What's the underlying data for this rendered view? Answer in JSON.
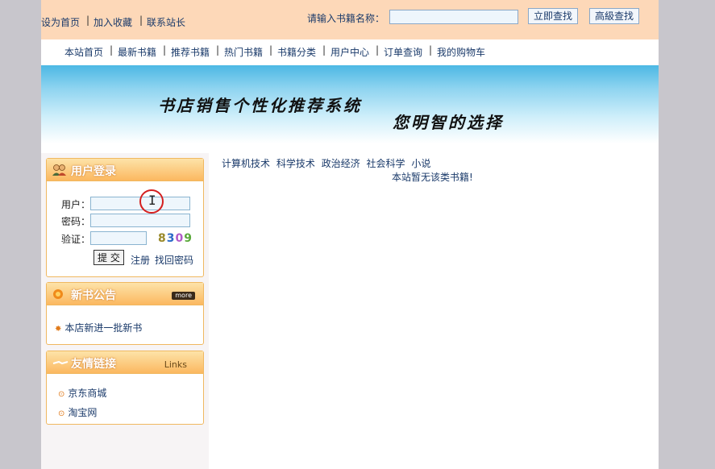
{
  "topbar": {
    "links": [
      "设为首页",
      "加入收藏",
      "联系站长"
    ],
    "search_label": "请输入书籍名称：",
    "search_value": "",
    "search_button": "立即查找",
    "advanced_button": "高級查找"
  },
  "nav": {
    "items": [
      "本站首页",
      "最新书籍",
      "推荐书籍",
      "热门书籍",
      "书籍分类",
      "用户中心",
      "订单查询",
      "我的购物车"
    ]
  },
  "banner": {
    "title": "书店销售个性化推荐系统",
    "slogan": "您明智的选择"
  },
  "login": {
    "title": "用户登录",
    "user_label": "用户：",
    "password_label": "密码：",
    "captcha_label": "验证：",
    "user_value": "",
    "password_value": "",
    "captcha_value": "",
    "captcha_digits": [
      "8",
      "3",
      "0",
      "9"
    ],
    "captcha_colors": [
      "#9a8a2a",
      "#2a6ac8",
      "#b05ac8",
      "#5aa83a"
    ],
    "submit": "提 交",
    "register": "注册",
    "recover": "找回密码"
  },
  "announcements": {
    "title": "新书公告",
    "more": "more",
    "items": [
      "本店新进一批新书"
    ]
  },
  "links": {
    "title": "友情链接",
    "tag": "Links",
    "items": [
      "京东商城",
      "淘宝网"
    ]
  },
  "main": {
    "categories": [
      "计算机技术",
      "科学技术",
      "政治经济",
      "社会科学",
      "小说"
    ],
    "empty_message": "本站暂无该类书籍!"
  },
  "colors": {
    "topbar_bg": "#fdd8b8",
    "link": "#1a3a6a",
    "panel_border": "#f0b860"
  }
}
